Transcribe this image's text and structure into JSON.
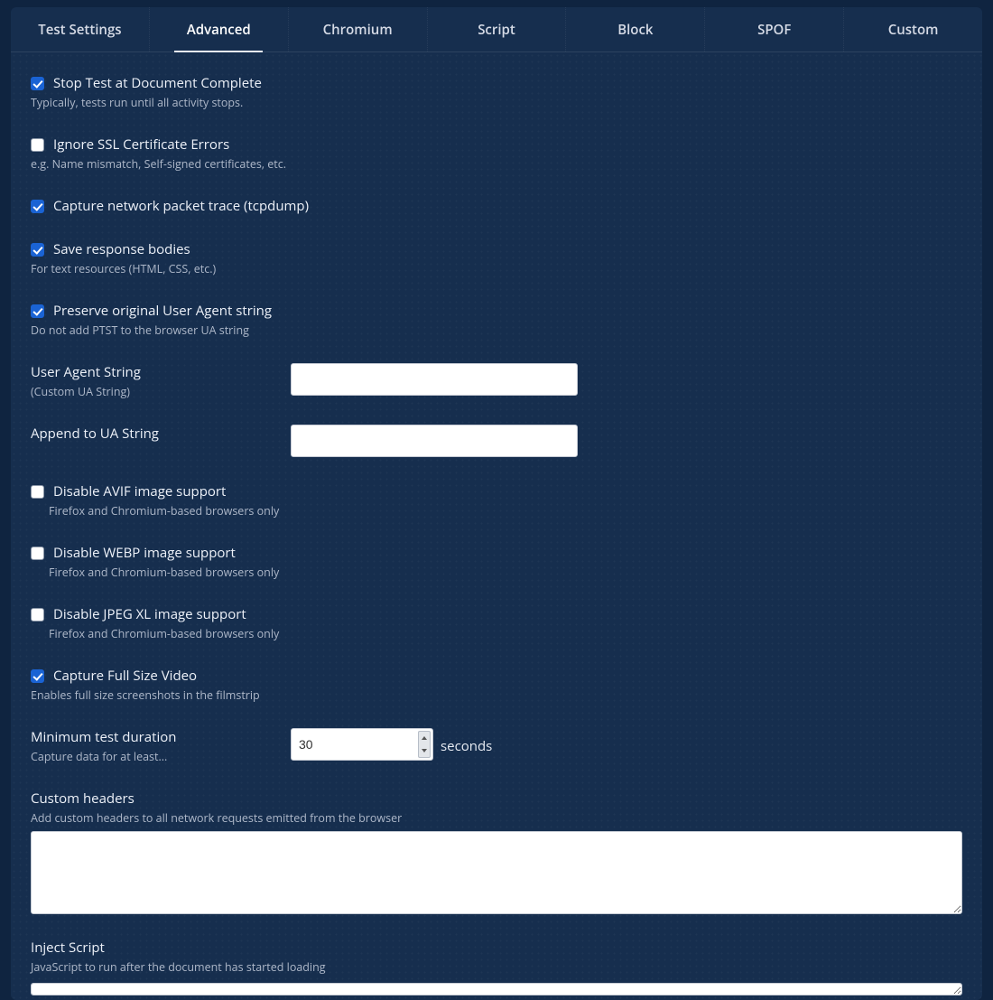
{
  "tabs": [
    {
      "label": "Test Settings",
      "active": false
    },
    {
      "label": "Advanced",
      "active": true
    },
    {
      "label": "Chromium",
      "active": false
    },
    {
      "label": "Script",
      "active": false
    },
    {
      "label": "Block",
      "active": false
    },
    {
      "label": "SPOF",
      "active": false
    },
    {
      "label": "Custom",
      "active": false
    }
  ],
  "opts": {
    "stop_doc_complete": {
      "label": "Stop Test at Document Complete",
      "desc": "Typically, tests run until all activity stops.",
      "checked": true
    },
    "ignore_ssl": {
      "label": "Ignore SSL Certificate Errors",
      "desc": "e.g. Name mismatch, Self-signed certificates, etc.",
      "checked": false
    },
    "capture_tcpdump": {
      "label": "Capture network packet trace (tcpdump)",
      "checked": true
    },
    "save_bodies": {
      "label": "Save response bodies",
      "desc": "For text resources (HTML, CSS, etc.)",
      "checked": true
    },
    "preserve_ua": {
      "label": "Preserve original User Agent string",
      "desc": "Do not add PTST to the browser UA string",
      "checked": true
    },
    "ua_string": {
      "label": "User Agent String",
      "desc": "(Custom UA String)",
      "value": ""
    },
    "append_ua": {
      "label": "Append to UA String",
      "value": ""
    },
    "disable_avif": {
      "label": "Disable AVIF image support",
      "desc": "Firefox and Chromium-based browsers only",
      "checked": false
    },
    "disable_webp": {
      "label": "Disable WEBP image support",
      "desc": "Firefox and Chromium-based browsers only",
      "checked": false
    },
    "disable_jxl": {
      "label": "Disable JPEG XL image support",
      "desc": "Firefox and Chromium-based browsers only",
      "checked": false
    },
    "full_video": {
      "label": "Capture Full Size Video",
      "desc": "Enables full size screenshots in the filmstrip",
      "checked": true
    },
    "min_duration": {
      "label": "Minimum test duration",
      "desc": "Capture data for at least...",
      "value": "30",
      "suffix": "seconds"
    },
    "custom_headers": {
      "label": "Custom headers",
      "desc": "Add custom headers to all network requests emitted from the browser",
      "value": ""
    },
    "inject_script": {
      "label": "Inject Script",
      "desc": "JavaScript to run after the document has started loading",
      "value": ""
    }
  }
}
